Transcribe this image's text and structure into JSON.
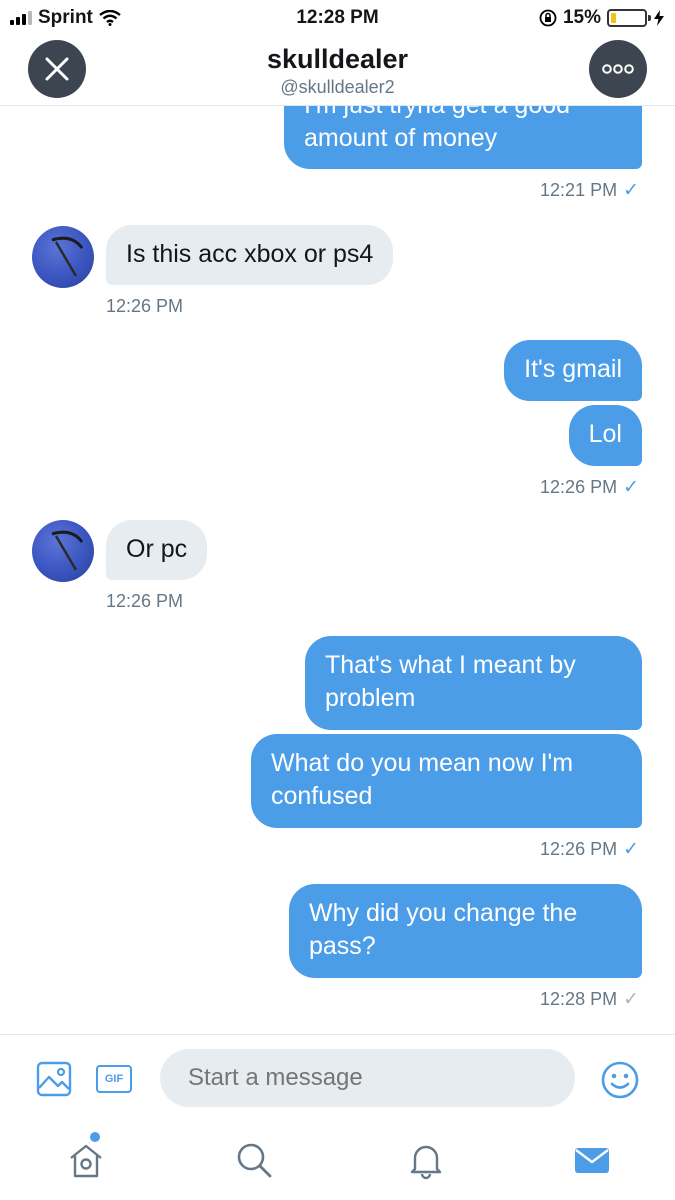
{
  "status_bar": {
    "carrier": "Sprint",
    "time": "12:28 PM",
    "battery": "15%",
    "battery_level": 0.15,
    "icons": [
      "signal-icon",
      "wifi-icon",
      "orientation-lock-icon",
      "battery-icon",
      "charging-bolt-icon"
    ]
  },
  "header": {
    "name": "skulldealer",
    "handle": "@skulldealer2",
    "close_icon": "close-icon",
    "more_icon": "more-options-icon"
  },
  "messages": [
    {
      "side": "out",
      "text": "I'm just tryna get a good amount of money"
    },
    {
      "timestamp": "12:21 PM",
      "read": true
    },
    {
      "side": "in",
      "text": "Is this acc xbox or ps4"
    },
    {
      "timestamp": "12:26 PM"
    },
    {
      "side": "out",
      "text": "It's gmail"
    },
    {
      "side": "out",
      "text": "Lol"
    },
    {
      "timestamp": "12:26 PM",
      "read": true
    },
    {
      "side": "in",
      "text": "Or pc"
    },
    {
      "timestamp": "12:26 PM"
    },
    {
      "side": "out",
      "text": "That's what I meant by problem"
    },
    {
      "side": "out",
      "text": "What do you mean now I'm confused"
    },
    {
      "timestamp": "12:26 PM",
      "read": true
    },
    {
      "side": "out",
      "text": "Why did you change the pass?"
    },
    {
      "timestamp": "12:28 PM",
      "read": false
    }
  ],
  "composer": {
    "placeholder": "Start a message",
    "gif_label": "GIF",
    "icons": [
      "image-icon",
      "gif-icon",
      "emoji-icon"
    ]
  },
  "tab_bar": {
    "tabs": [
      "home-icon",
      "search-icon",
      "notifications-icon",
      "messages-icon"
    ],
    "active": "messages-icon"
  },
  "colors": {
    "accent": "#4c9de8",
    "incoming_bubble": "#e6ecf0",
    "secondary_text": "#657786",
    "header_button": "#3d4650"
  }
}
